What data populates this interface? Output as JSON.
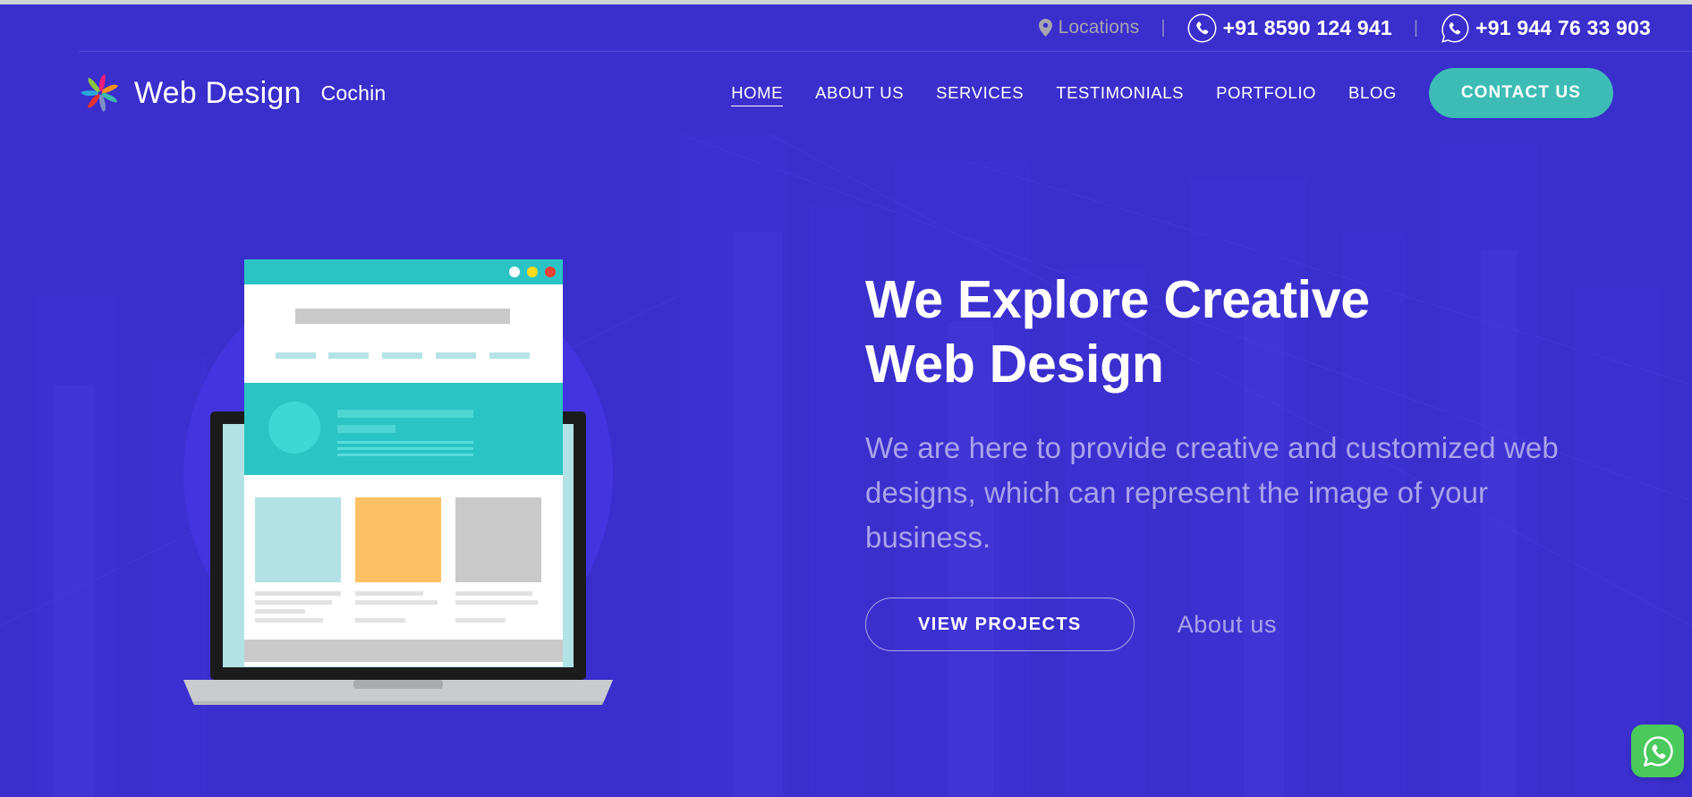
{
  "theme": {
    "bg": "#3a2ecc",
    "accent_teal": "#3dbcb5",
    "muted_lavender": "#a9a3ea",
    "whatsapp_green": "#4ac95c",
    "top_strip": "#cfd4d4"
  },
  "topbar": {
    "locations_label": "Locations",
    "locations_icon": "map-pin-icon",
    "separator": "|",
    "phone_icon": "phone-circle-icon",
    "whatsapp_icon": "whatsapp-circle-icon",
    "phone_1": "+91 8590 124 941",
    "phone_2": "+91 944 76 33 903"
  },
  "header": {
    "logo_icon": "pinwheel-logo-icon",
    "logo_text": "Web Design",
    "logo_subtext": "Cochin",
    "nav": [
      {
        "label": "HOME",
        "active": true
      },
      {
        "label": "ABOUT US",
        "active": false
      },
      {
        "label": "SERVICES",
        "active": false
      },
      {
        "label": "TESTIMONIALS",
        "active": false
      },
      {
        "label": "PORTFOLIO",
        "active": false
      },
      {
        "label": "BLOG",
        "active": false
      }
    ],
    "contact_button": "CONTACT US"
  },
  "hero": {
    "title_line_1": "We Explore Creative",
    "title_line_2": "Web Design",
    "subtitle": "We are here to provide creative and customized web designs, which can represent the image of your business.",
    "primary_button": "VIEW PROJECTS",
    "secondary_link": "About us",
    "illustration": {
      "name": "laptop-website-mockup",
      "browser_dots": [
        "white",
        "yellow",
        "red"
      ],
      "header_band_color": "#2bc4c4",
      "card_colors": [
        "#b2e2e5",
        "#fcc163",
        "#c9c9c9"
      ],
      "laptop_frame": "#1b1b1b",
      "laptop_base": "#c9cbce",
      "circle_backdrop": "#4334e0"
    }
  },
  "floating": {
    "whatsapp_label": "whatsapp-float-button"
  }
}
